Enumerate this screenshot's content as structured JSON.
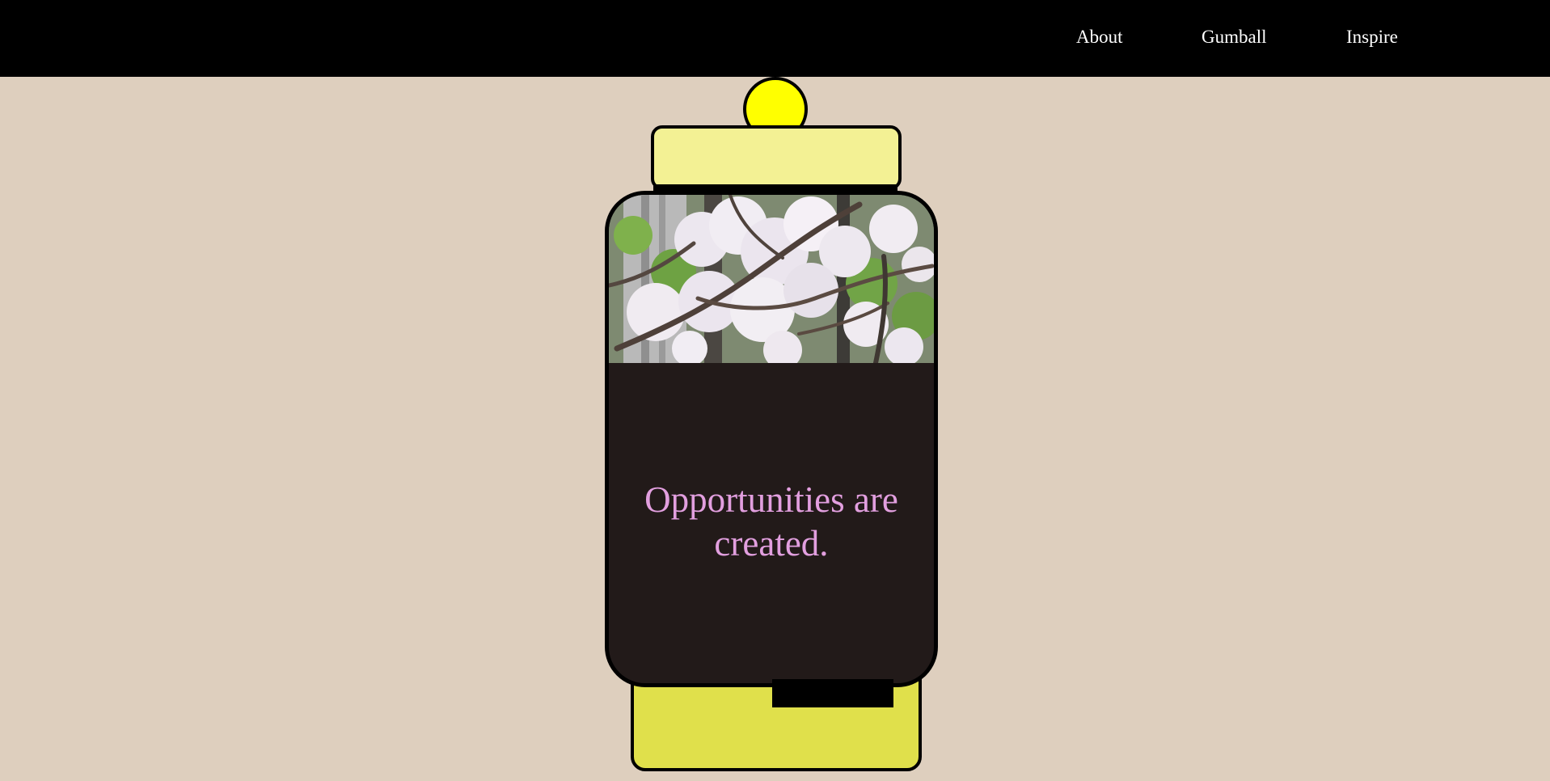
{
  "nav": {
    "items": [
      {
        "label": "About"
      },
      {
        "label": "Gumball"
      },
      {
        "label": "Inspire"
      }
    ]
  },
  "machine": {
    "quote": "Opportunities are created.",
    "image_subject": "cherry blossom branches",
    "colors": {
      "page_background": "#decfbe",
      "knob": "#ffff00",
      "cap": "#f3f194",
      "globe": "#221a19",
      "base": "#e0e04b",
      "quote_text": "#e29fdf",
      "topbar": "#000000"
    }
  }
}
